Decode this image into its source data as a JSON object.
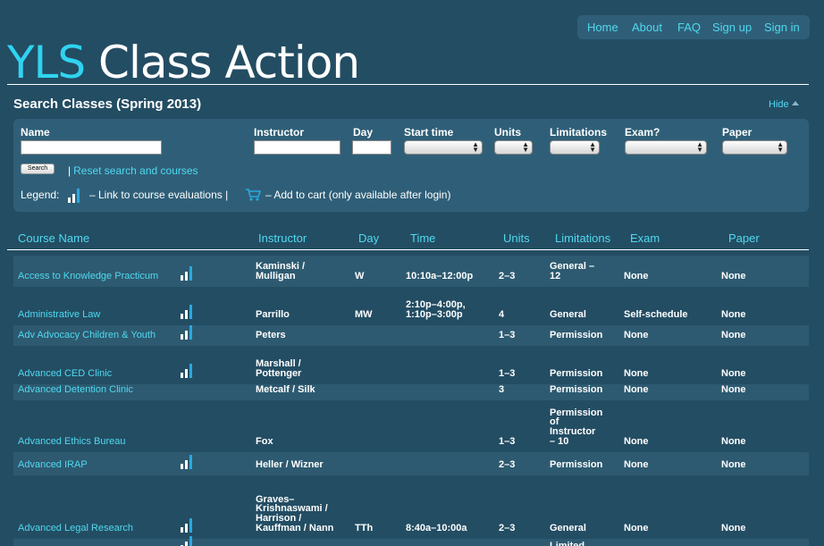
{
  "nav": {
    "items": [
      "Home",
      "About",
      "FAQ",
      "Sign up",
      "Sign in"
    ]
  },
  "logo": {
    "part1": "YLS",
    "part2": " Class Action"
  },
  "search": {
    "title": "Search Classes (Spring 2013)",
    "hide_label": "Hide",
    "labels": {
      "name": "Name",
      "instructor": "Instructor",
      "day": "Day",
      "start_time": "Start time",
      "units": "Units",
      "limitations": "Limitations",
      "exam": "Exam?",
      "paper": "Paper"
    },
    "search_button": "Search",
    "reset_pipe": "|",
    "reset_label": "Reset search and courses"
  },
  "legend": {
    "label": "Legend:",
    "eval_text": "– Link to course evaluations |",
    "cart_text": "– Add to cart (only available after login)"
  },
  "columns": [
    "Course Name",
    "Instructor",
    "Day",
    "Time",
    "Units",
    "Limitations",
    "Exam",
    "Paper"
  ],
  "rows": [
    {
      "name": "Access to Knowledge Practicum",
      "eval": true,
      "instructor": [
        "Kaminski /",
        "Mulligan"
      ],
      "day": "W",
      "time": [
        "10:10a–12:00p"
      ],
      "units": "2–3",
      "limitations": [
        "General –",
        "12"
      ],
      "exam": "None",
      "paper": "None"
    },
    {
      "name": "Administrative Law",
      "eval": true,
      "instructor": [
        "Parrillo"
      ],
      "day": "MW",
      "time": [
        "2:10p–4:00p,",
        "1:10p–3:00p"
      ],
      "units": "4",
      "limitations": [
        "General"
      ],
      "exam": "Self-schedule",
      "paper": "None"
    },
    {
      "name": "Adv Advocacy Children & Youth",
      "eval": true,
      "instructor": [
        "Peters"
      ],
      "day": "",
      "time": [],
      "units": "1–3",
      "limitations": [
        "Permission"
      ],
      "exam": "None",
      "paper": "None"
    },
    {
      "name": "Advanced CED Clinic",
      "eval": true,
      "instructor": [
        "Marshall /",
        "Pottenger"
      ],
      "day": "",
      "time": [],
      "units": "1–3",
      "limitations": [
        "Permission"
      ],
      "exam": "None",
      "paper": "None"
    },
    {
      "name": "Advanced Detention Clinic",
      "eval": false,
      "instructor": [
        "Metcalf / Silk"
      ],
      "day": "",
      "time": [],
      "units": "3",
      "limitations": [
        "Permission"
      ],
      "exam": "None",
      "paper": "None"
    },
    {
      "name": "Advanced Ethics Bureau",
      "eval": false,
      "instructor": [
        "Fox"
      ],
      "day": "",
      "time": [],
      "units": "1–3",
      "limitations": [
        "Permission",
        "of",
        "Instructor",
        "– 10"
      ],
      "exam": "None",
      "paper": "None"
    },
    {
      "name": "Advanced IRAP",
      "eval": true,
      "instructor": [
        "Heller / Wizner"
      ],
      "day": "",
      "time": [],
      "units": "2–3",
      "limitations": [
        "Permission"
      ],
      "exam": "None",
      "paper": "None"
    },
    {
      "name": "Advanced Legal Research",
      "eval": true,
      "instructor": [
        "Graves–",
        "Krishnaswami /",
        "Harrison /",
        "Kauffman / Nann"
      ],
      "day": "TTh",
      "time": [
        "8:40a–10:00a"
      ],
      "units": "2–3",
      "limitations": [
        "General"
      ],
      "exam": "None",
      "paper": "None"
    },
    {
      "name": "",
      "eval": true,
      "instructor": [],
      "day": "",
      "time": [],
      "units": "",
      "limitations": [
        "Limited"
      ],
      "exam": "",
      "paper": ""
    }
  ]
}
